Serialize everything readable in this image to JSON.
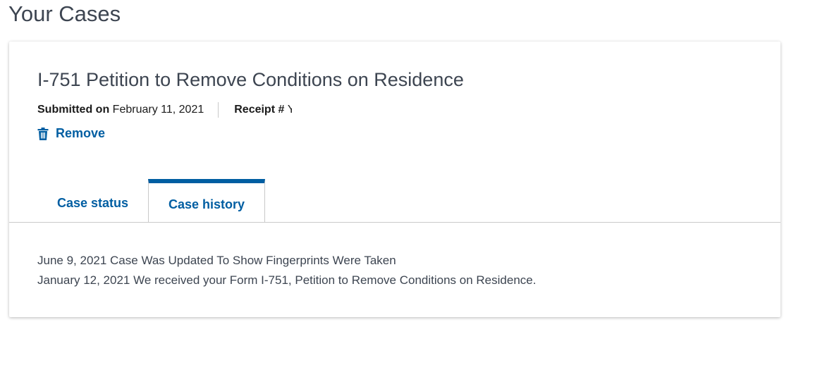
{
  "page": {
    "title": "Your Cases"
  },
  "case": {
    "title": "I-751 Petition to Remove Conditions on Residence",
    "submitted_label": "Submitted on",
    "submitted_date": "February 11, 2021",
    "receipt_label": "Receipt #",
    "receipt_value": "Y",
    "remove_label": "Remove",
    "icons": {
      "remove": "trash-icon"
    }
  },
  "tabs": [
    {
      "label": "Case status",
      "active": false
    },
    {
      "label": "Case history",
      "active": true
    }
  ],
  "history": [
    "June 9, 2021 Case Was Updated To Show Fingerprints Were Taken",
    "January 12, 2021 We received your Form I-751, Petition to Remove Conditions on Residence."
  ],
  "colors": {
    "link": "#005ea2",
    "active_tab_border": "#005ea2",
    "title": "#3d4551"
  }
}
